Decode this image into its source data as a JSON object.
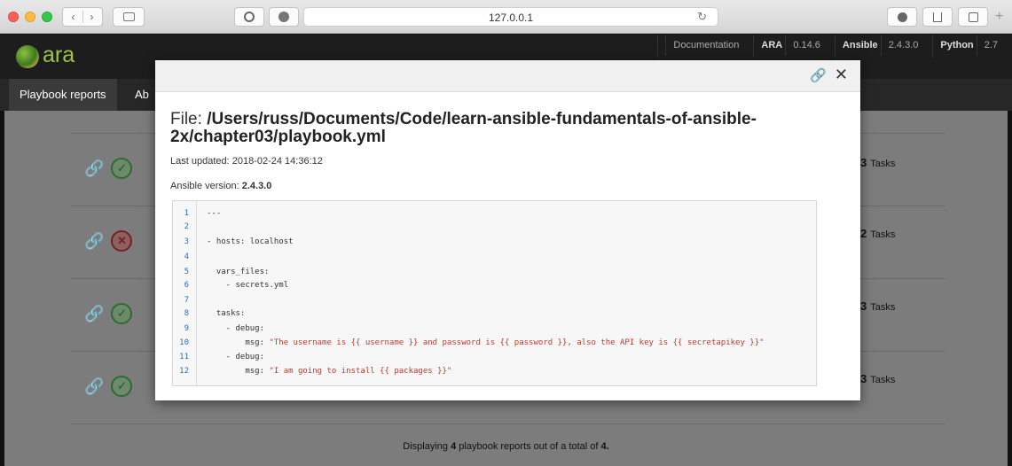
{
  "browser": {
    "url": "127.0.0.1",
    "back_label": "‹",
    "forward_label": "›",
    "reload_glyph": "↻"
  },
  "app": {
    "logo_text": "ara",
    "toplinks": [
      {
        "label": "Documentation"
      },
      {
        "label": "ARA",
        "value": "0.14.6"
      },
      {
        "label": "Ansible",
        "value": "2.4.3.0"
      },
      {
        "label": "Python",
        "value": "2.7"
      }
    ],
    "nav": [
      "Playbook reports",
      "Ab"
    ]
  },
  "background_rows": [
    {
      "status": "ok",
      "tasks_count": "3",
      "tasks_label": "Tasks"
    },
    {
      "status": "fail",
      "tasks_count": "2",
      "tasks_label": "Tasks"
    },
    {
      "status": "ok",
      "tasks_count": "3",
      "tasks_label": "Tasks"
    },
    {
      "status": "ok",
      "tasks_count": "3",
      "tasks_label": "Tasks"
    }
  ],
  "footer": {
    "prefix": "Displaying",
    "shown": "4",
    "middle": "playbook reports out of a total of",
    "total": "4."
  },
  "modal": {
    "file_prefix": "File: ",
    "file_path": "/Users/russ/Documents/Code/learn-ansible-fundamentals-of-ansible-2x/chapter03/playbook.yml",
    "updated_label": "Last updated:",
    "updated_value": "2018-02-24 14:36:12",
    "version_label": "Ansible version:",
    "version_value": "2.4.3.0",
    "code_lines": [
      {
        "n": "1",
        "text": "---"
      },
      {
        "n": "2",
        "text": ""
      },
      {
        "n": "3",
        "text": "- hosts: localhost"
      },
      {
        "n": "4",
        "text": ""
      },
      {
        "n": "5",
        "text": "  vars_files:"
      },
      {
        "n": "6",
        "text": "    - secrets.yml"
      },
      {
        "n": "7",
        "text": ""
      },
      {
        "n": "8",
        "text": "  tasks:"
      },
      {
        "n": "9",
        "text": "    - debug:"
      },
      {
        "n": "10",
        "text": "        msg: ",
        "str": "\"The username is {{ username }} and password is {{ password }}, also the API key is {{ secretapikey }}\""
      },
      {
        "n": "11",
        "text": "    - debug:"
      },
      {
        "n": "12",
        "text": "        msg: ",
        "str": "\"I am going to install {{ packages }}\""
      }
    ]
  },
  "colors": {
    "accent": "#1b8ad1",
    "success": "#2f6b2f",
    "failure": "#7a1f1f",
    "code_string": "#c0392b"
  }
}
